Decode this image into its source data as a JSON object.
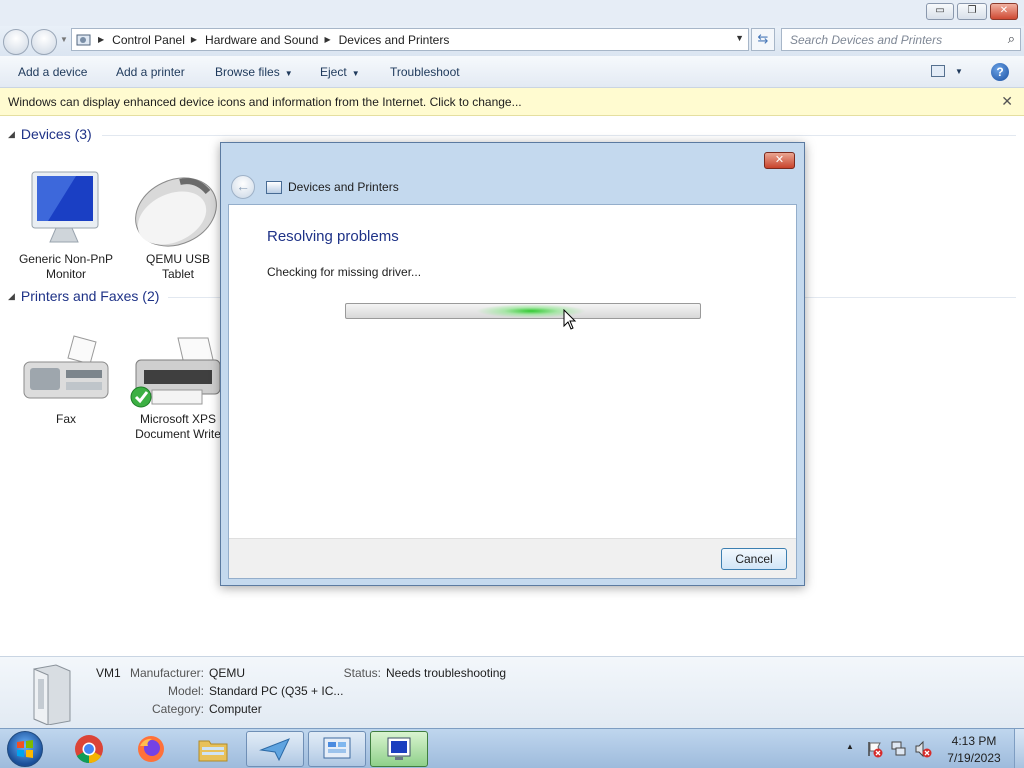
{
  "window": {
    "minimize_glyph": "▭",
    "maximize_glyph": "❐",
    "close_glyph": "✕"
  },
  "address": {
    "segments": [
      "Control Panel",
      "Hardware and Sound",
      "Devices and Printers"
    ],
    "search_placeholder": "Search Devices and Printers"
  },
  "toolbar": {
    "add_device": "Add a device",
    "add_printer": "Add a printer",
    "browse_files": "Browse files",
    "eject": "Eject",
    "troubleshoot": "Troubleshoot",
    "help_glyph": "?"
  },
  "infobar": {
    "text": "Windows can display enhanced device icons and information from the Internet. Click to change...",
    "close_glyph": "✕"
  },
  "groups": {
    "devices": {
      "title": "Devices (3)",
      "items": [
        {
          "label_line1": "Generic Non-PnP",
          "label_line2": "Monitor"
        },
        {
          "label_line1": "QEMU USB",
          "label_line2": "Tablet"
        }
      ]
    },
    "printers": {
      "title": "Printers and Faxes (2)",
      "items": [
        {
          "label_line1": "Fax",
          "label_line2": ""
        },
        {
          "label_line1": "Microsoft XPS",
          "label_line2": "Document Write"
        }
      ]
    }
  },
  "dialog": {
    "title": "Devices and Printers",
    "heading": "Resolving problems",
    "status": "Checking for missing driver...",
    "cancel_label": "Cancel",
    "close_glyph": "✕",
    "back_glyph": "←"
  },
  "details": {
    "name": "VM1",
    "manufacturer_key": "Manufacturer:",
    "manufacturer": "QEMU",
    "model_key": "Model:",
    "model": "Standard PC (Q35 + IC...",
    "category_key": "Category:",
    "category": "Computer",
    "status_key": "Status:",
    "status": "Needs troubleshooting"
  },
  "taskbar": {
    "time": "4:13 PM",
    "date": "7/19/2023",
    "tray_expand_glyph": "▲"
  },
  "colors": {
    "accent_heading": "#1e3287",
    "infobar_bg": "#fffbd0",
    "progress_green": "#28c828"
  }
}
